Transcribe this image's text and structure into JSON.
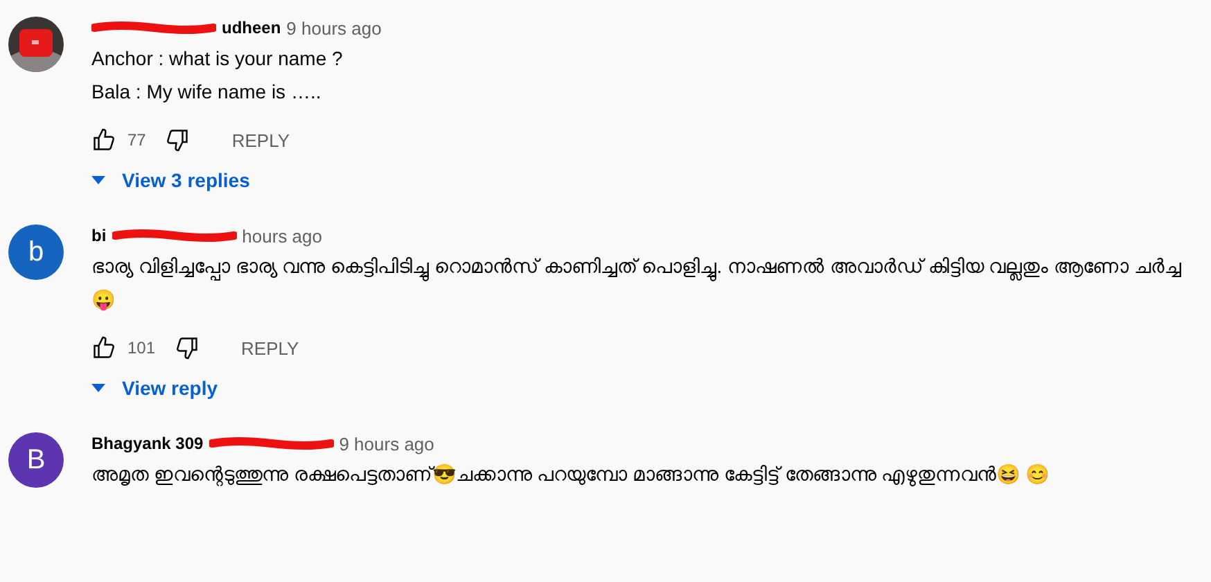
{
  "comments": [
    {
      "avatar": {
        "kind": "picture"
      },
      "author": [
        {
          "kind": "scribble"
        },
        {
          "kind": "text",
          "text": "udheen"
        }
      ],
      "time": "9 hours ago",
      "lines": [
        "Anchor : what is your name ?",
        "Bala : My wife name is ….."
      ],
      "likes": "77",
      "reply": "REPLY",
      "replies": "View 3 replies"
    },
    {
      "avatar": {
        "kind": "letter",
        "letter": "b",
        "color": "#1565c0"
      },
      "author": [
        {
          "kind": "text",
          "text": "bi"
        },
        {
          "kind": "scribble"
        }
      ],
      "time": "hours ago",
      "lines": [
        "ഭാര്യ വിളിച്ചപ്പോ ഭാര്യ വന്നു കെട്ടിപിടിച്ചു റൊമാൻസ് കാണിച്ചത് പൊളിച്ചു. നാഷണൽ അവാർഡ് കിട്ടിയ വല്ലതും ആണോ ചർച്ച 😛"
      ],
      "likes": "101",
      "reply": "REPLY",
      "replies": "View reply"
    },
    {
      "avatar": {
        "kind": "letter",
        "letter": "B",
        "color": "#5e35b1"
      },
      "author": [
        {
          "kind": "text",
          "text": "Bhagyank 309"
        },
        {
          "kind": "scribble"
        }
      ],
      "time": "9 hours ago",
      "lines": [
        "അമൃത ഇവന്റെടുത്തുന്നു രക്ഷപെട്ടതാണ്😎ചക്കാന്നു പറയുമ്പോ മാങ്ങാന്നു കേട്ടിട്ട് തേങ്ങാന്നു എഴുതുന്നവൻ😆 😊"
      ]
    }
  ]
}
